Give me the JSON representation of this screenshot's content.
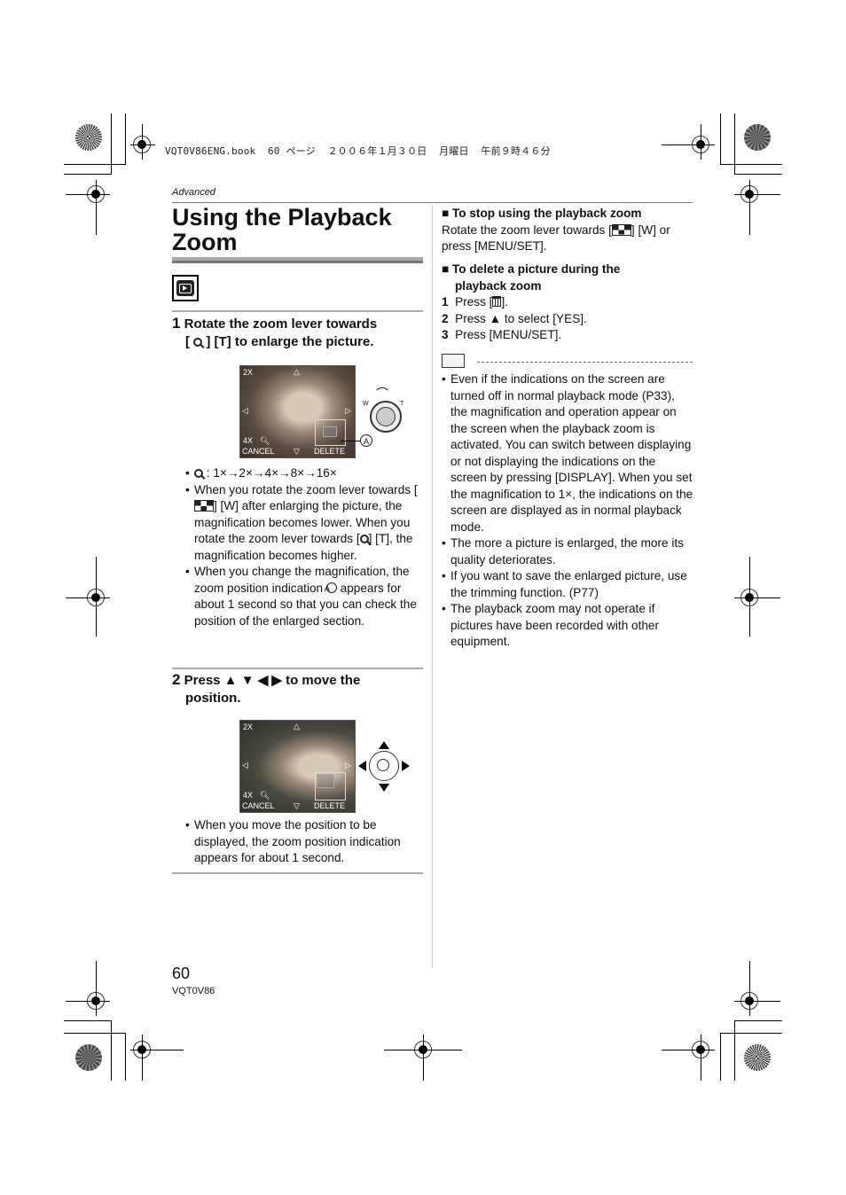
{
  "print_header": "VQT0V86ENG.book  60 ページ  ２００６年１月３０日  月曜日  午前９時４６分",
  "section_label": "Advanced",
  "page_title_line1": "Using the Playback",
  "page_title_line2": "Zoom",
  "mode_icon": "playback-mode-icon",
  "step1": {
    "number": "1",
    "text_line1": "Rotate the zoom lever towards",
    "text_line2_pre": "[ ",
    "text_line2_post": " ] [T] to enlarge the picture.",
    "screen": {
      "top_left": "2X",
      "mid_left": "4X",
      "cancel": "CANCEL",
      "delete": "DELETE",
      "lever_w": "W",
      "lever_t": "T",
      "callout": "A"
    }
  },
  "magnification_sequence": ":  1×→2×→4×→8×→16×",
  "step1_bullets": {
    "b1_a": "When you rotate the zoom lever towards [",
    "b1_b": "] [W] after enlarging the picture, the magnification becomes lower. When you rotate the zoom lever towards [",
    "b1_c": "] [T], the magnification becomes higher.",
    "b2_a": "When you change the magnification, the zoom position indication ",
    "b2_callout": "A",
    "b2_b": " appears for about 1 second so that you can check the position of the enlarged section."
  },
  "step2": {
    "number": "2",
    "text_line1": "Press ▲ ▼ ◀ ▶ to move the",
    "text_line2": "position.",
    "screen": {
      "top_left": "2X",
      "mid_left": "4X",
      "cancel": "CANCEL",
      "delete": "DELETE"
    }
  },
  "step2_bullet": "When you move the position to be displayed, the zoom position indication appears for about 1 second.",
  "stop_zoom": {
    "heading": "To stop using the playback zoom",
    "text_a": "Rotate the zoom lever towards [",
    "text_b": "] [W] or press [MENU/SET]."
  },
  "delete_zoom": {
    "heading_line1": "To delete a picture during the",
    "heading_line2": "playback zoom",
    "steps": [
      {
        "num": "1",
        "pre": "Press [",
        "post": "]."
      },
      {
        "num": "2",
        "text": "Press ▲ to select [YES]."
      },
      {
        "num": "3",
        "text": "Press [MENU/SET]."
      }
    ]
  },
  "notes": [
    "Even if the indications on the screen are turned off in normal playback mode (P33), the magnification and operation appear on the screen when the playback zoom is activated. You can switch between displaying or not displaying the indications on the screen by pressing [DISPLAY]. When you set the magnification to 1×, the indications on the screen are displayed as in normal playback mode.",
    "The more a picture is enlarged, the more its quality deteriorates.",
    "If you want to save the enlarged picture, use the trimming function. (P77)",
    "The playback zoom may not operate if pictures have been recorded with other equipment."
  ],
  "footer": {
    "page_number": "60",
    "model_code": "VQT0V86"
  }
}
